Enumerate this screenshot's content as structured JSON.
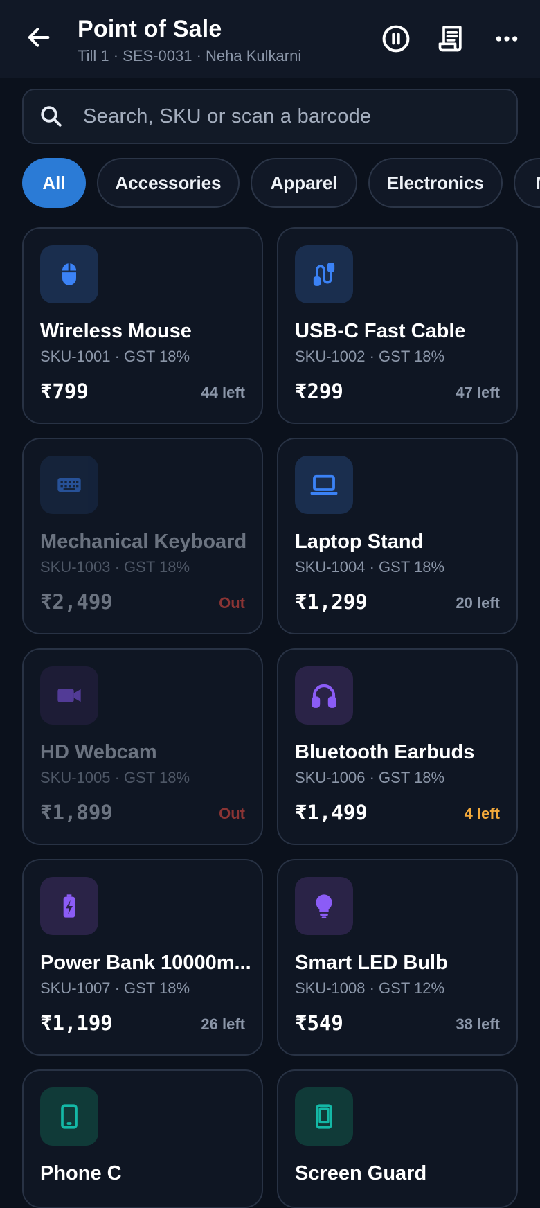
{
  "header": {
    "title": "Point of Sale",
    "subtitle": "Till 1 · SES-0031 · Neha Kulkarni",
    "icons": [
      "back-arrow-icon",
      "pause-icon",
      "receipt-icon",
      "more-icon"
    ]
  },
  "search": {
    "placeholder": "Search, SKU or scan a barcode",
    "value": ""
  },
  "categories": [
    {
      "label": "All",
      "selected": true
    },
    {
      "label": "Accessories",
      "selected": false
    },
    {
      "label": "Apparel",
      "selected": false
    },
    {
      "label": "Electronics",
      "selected": false
    },
    {
      "label": "M",
      "selected": false
    }
  ],
  "colors": {
    "accent": "#2b7bd6",
    "low_stock": "#f2a93b",
    "out_of_stock": "#8a3434",
    "icon_blue": "#3b82f6",
    "icon_purple": "#8b5cf6",
    "icon_teal": "#14b8a6"
  },
  "products": [
    {
      "name": "Wireless Mouse",
      "meta": "SKU-1001 · GST 18%",
      "price": "₹799",
      "stock": "44 left",
      "icon": "mouse-icon",
      "available": true
    },
    {
      "name": "USB-C Fast Cable",
      "meta": "SKU-1002 · GST 18%",
      "price": "₹299",
      "stock": "47 left",
      "icon": "cable-icon",
      "available": true
    },
    {
      "name": "Mechanical Keyboard",
      "meta": "SKU-1003 · GST 18%",
      "price": "₹2,499",
      "stock": "Out",
      "icon": "keyboard-icon",
      "available": false
    },
    {
      "name": "Laptop Stand",
      "meta": "SKU-1004 · GST 18%",
      "price": "₹1,299",
      "stock": "20 left",
      "icon": "laptop-icon",
      "available": true
    },
    {
      "name": "HD Webcam",
      "meta": "SKU-1005 · GST 18%",
      "price": "₹1,899",
      "stock": "Out",
      "icon": "video-camera-icon",
      "available": false
    },
    {
      "name": "Bluetooth Earbuds",
      "meta": "SKU-1006 · GST 18%",
      "price": "₹1,499",
      "stock": "4 left",
      "icon": "headphones-icon",
      "available": true
    },
    {
      "name": "Power Bank 10000m...",
      "meta": "SKU-1007 · GST 18%",
      "price": "₹1,199",
      "stock": "26 left",
      "icon": "battery-charging-icon",
      "available": true
    },
    {
      "name": "Smart LED Bulb",
      "meta": "SKU-1008 · GST 12%",
      "price": "₹549",
      "stock": "38 left",
      "icon": "lightbulb-icon",
      "available": true
    },
    {
      "name": "Phone C",
      "icon": "phone-icon"
    },
    {
      "name": "Screen Guard",
      "icon": "phone-icon"
    }
  ]
}
